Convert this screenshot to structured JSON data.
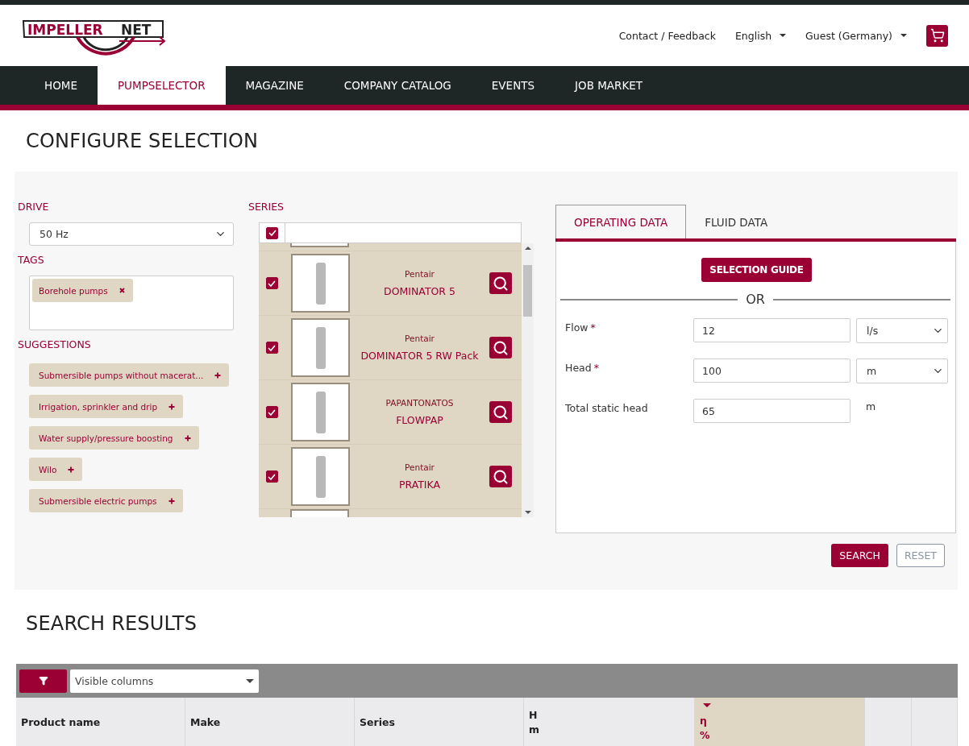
{
  "logo": {
    "left": "IMPELLER",
    "right": "NET"
  },
  "header_links": [
    {
      "label": "Contact / Feedback",
      "dropdown": false
    },
    {
      "label": "English",
      "dropdown": true
    },
    {
      "label": "Guest (Germany)",
      "dropdown": true
    }
  ],
  "nav": [
    {
      "label": "HOME",
      "selected": false
    },
    {
      "label": "PUMPSELECTOR",
      "selected": true
    },
    {
      "label": "MAGAZINE",
      "selected": false
    },
    {
      "label": "COMPANY CATALOG",
      "selected": false
    },
    {
      "label": "EVENTS",
      "selected": false
    },
    {
      "label": "JOB MARKET",
      "selected": false
    }
  ],
  "configure_title": "CONFIGURE SELECTION",
  "drive": {
    "label": "DRIVE",
    "value": "50 Hz"
  },
  "tags": {
    "label": "TAGS",
    "items": [
      "Borehole pumps"
    ]
  },
  "suggestions": {
    "label": "SUGGESTIONS",
    "items": [
      "Submersible pumps without macerat...",
      "Irrigation, sprinkler and drip",
      "Water supply/pressure boosting",
      "Wilo",
      "Submersible electric pumps"
    ]
  },
  "series": {
    "label": "SERIES",
    "all_checked": true,
    "items": [
      {
        "make": "Pentair",
        "name": "DOMINATOR 5",
        "checked": true
      },
      {
        "make": "Pentair",
        "name": "DOMINATOR 5 RW Pack",
        "checked": true
      },
      {
        "make": "PAPANTONATOS",
        "name": "FLOWPAP",
        "checked": true
      },
      {
        "make": "Pentair",
        "name": "PRATIKA",
        "checked": true
      }
    ]
  },
  "tabs": [
    {
      "label": "OPERATING DATA",
      "selected": true
    },
    {
      "label": "FLUID DATA",
      "selected": false
    }
  ],
  "selection_guide": "SELECTION GUIDE",
  "or": "OR",
  "required_mark": "*",
  "fields": [
    {
      "label": "Flow",
      "required": true,
      "value": "12",
      "unit": "l/s",
      "kind": "select"
    },
    {
      "label": "Head",
      "required": true,
      "value": "100",
      "unit": "m",
      "kind": "select"
    },
    {
      "label": "Total static head",
      "required": false,
      "value": "65",
      "unit": "m",
      "kind": "text"
    }
  ],
  "buttons": {
    "search": "SEARCH",
    "reset": "RESET"
  },
  "results_title": "SEARCH RESULTS",
  "visible_columns": {
    "placeholder": "Visible columns"
  },
  "table": {
    "columns": [
      {
        "label": "Product name",
        "sorted": false
      },
      {
        "label": "Make",
        "sorted": false
      },
      {
        "label": "Series",
        "sorted": false
      },
      {
        "label": "H",
        "unit": "m",
        "sorted": false
      },
      {
        "label": "η",
        "unit": "%",
        "sorted": true
      },
      {
        "sorted": false
      },
      {
        "sorted": false
      }
    ]
  }
}
